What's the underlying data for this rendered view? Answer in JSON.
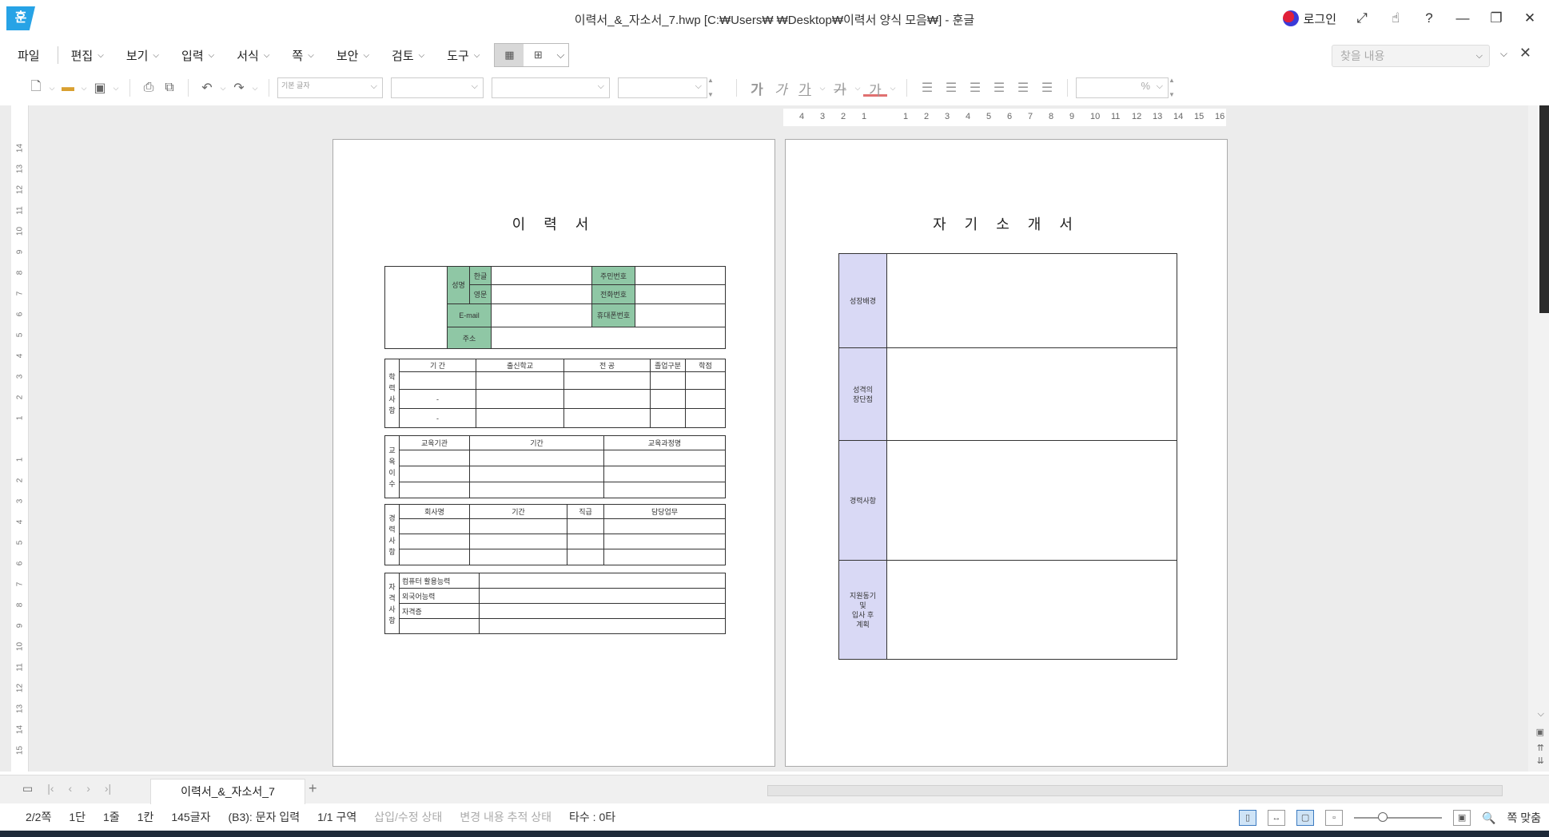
{
  "titlebar": {
    "logo": "훈",
    "title": "이력서_&_자소서_7.hwp [C:₩Users₩        ₩Desktop₩이력서 양식 모음₩] - 훈글",
    "login": "로그인"
  },
  "menu": {
    "items": [
      "파일",
      "편집",
      "보기",
      "입력",
      "서식",
      "쪽",
      "보안",
      "검토",
      "도구"
    ],
    "find_placeholder": "찾을 내용"
  },
  "toolbar": {
    "style_combo": "기본\n글자",
    "percent": "%",
    "format_glyphs": [
      "가",
      "가",
      "가",
      "가",
      "가"
    ]
  },
  "ruler": {
    "top_ticks": [
      "4",
      "3",
      "2",
      "1",
      "",
      "1",
      "2",
      "3",
      "4",
      "5",
      "6",
      "7",
      "8",
      "9",
      "10",
      "11",
      "12",
      "13",
      "14",
      "15",
      "16"
    ],
    "left_ticks": [
      "14",
      "13",
      "12",
      "11",
      "10",
      "9",
      "8",
      "7",
      "6",
      "5",
      "4",
      "3",
      "2",
      "1",
      "",
      "1",
      "2",
      "3",
      "4",
      "5",
      "6",
      "7",
      "8",
      "9",
      "10",
      "11",
      "12",
      "13",
      "14",
      "15"
    ]
  },
  "page1": {
    "title": "이 력 서",
    "personal": {
      "name": "성명",
      "hangul": "한글",
      "english": "영문",
      "email": "E-mail",
      "address": "주소",
      "rrn": "주민번호",
      "phone": "전화번호",
      "mobile": "휴대폰번호"
    },
    "education": {
      "side": [
        "학",
        "력",
        "사",
        "항"
      ],
      "headers": [
        "기  간",
        "출신학교",
        "전  공",
        "졸업구분",
        "학점"
      ],
      "dashes": [
        "-",
        "-"
      ]
    },
    "training": {
      "side": [
        "교",
        "육",
        "이",
        "수"
      ],
      "headers": [
        "교육기관",
        "기간",
        "교육과정명"
      ]
    },
    "career": {
      "side": [
        "경",
        "력",
        "사",
        "항"
      ],
      "headers": [
        "회사명",
        "기간",
        "직급",
        "담당업무"
      ]
    },
    "qualification": {
      "side": [
        "자",
        "격",
        "사",
        "항"
      ],
      "rows": [
        "컴퓨터 활용능력",
        "외국어능력",
        "자격증",
        ""
      ]
    }
  },
  "page2": {
    "title": "자 기 소 개 서",
    "sections": [
      "성장배경",
      "성격의\n장단점",
      "경력사항",
      "지원동기\n및\n입사 후\n계획"
    ]
  },
  "tabs": {
    "doc_tab": "이력서_&_자소서_7",
    "add": "+"
  },
  "status": {
    "page": "2/2쪽",
    "column": "1단",
    "line": "1줄",
    "col": "1칸",
    "chars": "145글자",
    "mode": "(B3): 문자 입력",
    "section": "1/1 구역",
    "insert_state": "삽입/수정 상태",
    "track_state": "변경 내용 추적 상태",
    "typing": "타수 : 0타",
    "fit": "쪽 맞춤"
  }
}
